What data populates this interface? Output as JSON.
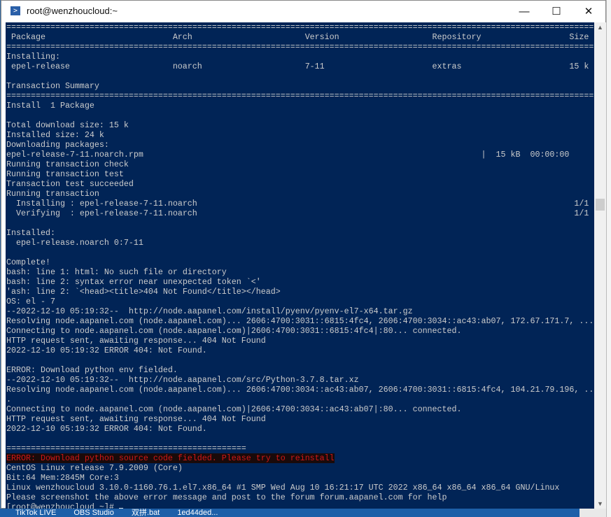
{
  "window": {
    "title": "root@wenzhoucloud:~",
    "minimize": "—",
    "maximize": "☐",
    "close": "✕",
    "icon": "powershell-icon"
  },
  "taskbar": [
    "TikTok LIVE",
    "OBS Studio",
    "双拼.bat",
    "1ed44ded..."
  ],
  "colors": {
    "background": "#012456",
    "text": "#cccccc",
    "error": "#d01818"
  },
  "sep": "========================================================================================================================",
  "sep_short": "=================================================",
  "table": {
    "header": [
      "Package",
      "Arch",
      "Version",
      "Repository",
      "Size"
    ],
    "group": "Installing:",
    "row": [
      "epel-release",
      "noarch",
      "7-11",
      "extras",
      "15 k"
    ]
  },
  "summary": {
    "title": "Transaction Summary",
    "install": "Install  1 Package",
    "total": "Total download size: 15 k",
    "installed_size": "Installed size: 24 k",
    "downloading": "Downloading packages:",
    "rpm": "epel-release-7-11.noarch.rpm",
    "rpm_progress": "|  15 kB  00:00:00",
    "check": "Running transaction check",
    "test": "Running transaction test",
    "succeeded": "Transaction test succeeded",
    "running": "Running transaction",
    "installing": "  Installing : epel-release-7-11.noarch",
    "installing_count": "1/1",
    "verifying": "  Verifying  : epel-release-7-11.noarch",
    "verifying_count": "1/1",
    "installed": "Installed:",
    "installed_pkg": "  epel-release.noarch 0:7-11",
    "complete": "Complete!"
  },
  "log1": [
    "bash: line 1: html: No such file or directory",
    "bash: line 2: syntax error near unexpected token `<'",
    "'ash: line 2: `<head><title>404 Not Found</title></head>",
    "OS: el - 7",
    "--2022-12-10 05:19:32--  http://node.aapanel.com/install/pyenv/pyenv-el7-x64.tar.gz",
    "Resolving node.aapanel.com (node.aapanel.com)... 2606:4700:3031::6815:4fc4, 2606:4700:3034::ac43:ab07, 172.67.171.7, ...",
    "Connecting to node.aapanel.com (node.aapanel.com)|2606:4700:3031::6815:4fc4|:80... connected.",
    "HTTP request sent, awaiting response... 404 Not Found",
    "2022-12-10 05:19:32 ERROR 404: Not Found."
  ],
  "log2": [
    "ERROR: Download python env fielded.",
    "--2022-12-10 05:19:32--  http://node.aapanel.com/src/Python-3.7.8.tar.xz",
    "Resolving node.aapanel.com (node.aapanel.com)... 2606:4700:3034::ac43:ab07, 2606:4700:3031::6815:4fc4, 104.21.79.196, ..",
    ".",
    "Connecting to node.aapanel.com (node.aapanel.com)|2606:4700:3034::ac43:ab07|:80... connected.",
    "HTTP request sent, awaiting response... 404 Not Found",
    "2022-12-10 05:19:32 ERROR 404: Not Found."
  ],
  "error_line": "ERROR: Download python source code fielded. Please try to reinstall",
  "sysinfo": [
    "CentOS Linux release 7.9.2009 (Core)",
    "Bit:64 Mem:2845M Core:3",
    "Linux wenzhoucloud 3.10.0-1160.76.1.el7.x86_64 #1 SMP Wed Aug 10 16:21:17 UTC 2022 x86_64 x86_64 x86_64 GNU/Linux",
    "Please screenshot the above error message and post to the forum forum.aapanel.com for help"
  ],
  "prompt": "[root@wenzhoucloud ~]# "
}
